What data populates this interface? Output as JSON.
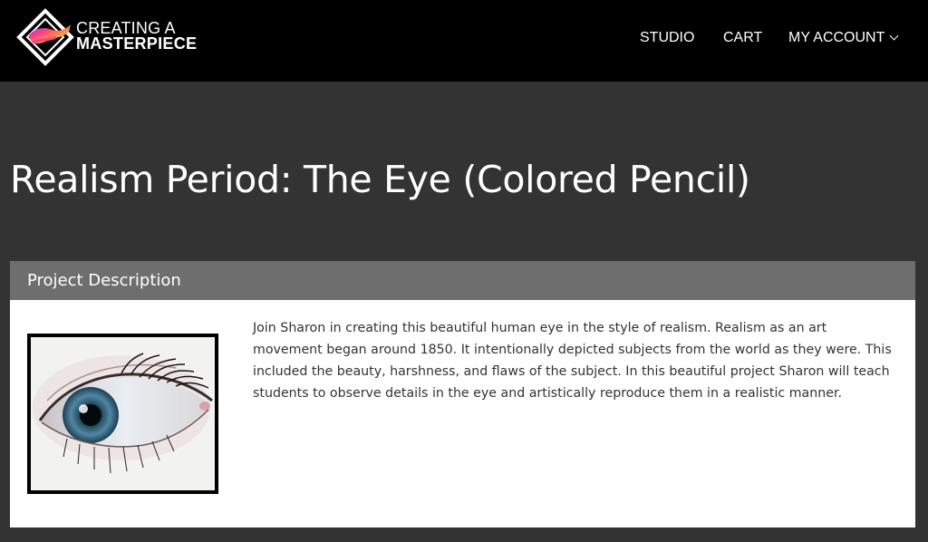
{
  "brand": {
    "line1": "CREATING A",
    "line2": "MASTERPIECE"
  },
  "nav": {
    "items": [
      {
        "label": "STUDIO"
      },
      {
        "label": "CART"
      },
      {
        "label": "MY ACCOUNT",
        "icon": "chevron-down-icon"
      }
    ]
  },
  "page": {
    "title": "Realism Period: The Eye (Colored Pencil)"
  },
  "panel": {
    "header": "Project Description",
    "image_icon": "eye-drawing-image",
    "description": "Join Sharon in creating this beautiful human eye in the style of realism. Realism as an art movement began around 1850. It intentionally depicted subjects from the world as they were. This included the beauty, harshness, and flaws of the subject. In this beautiful project Sharon will teach students to observe details in the eye and artistically reproduce them in a realistic manner."
  },
  "colors": {
    "header_bg": "#000000",
    "page_bg": "#333333",
    "panel_header_bg": "#6e6e6e",
    "panel_bg": "#ffffff"
  }
}
